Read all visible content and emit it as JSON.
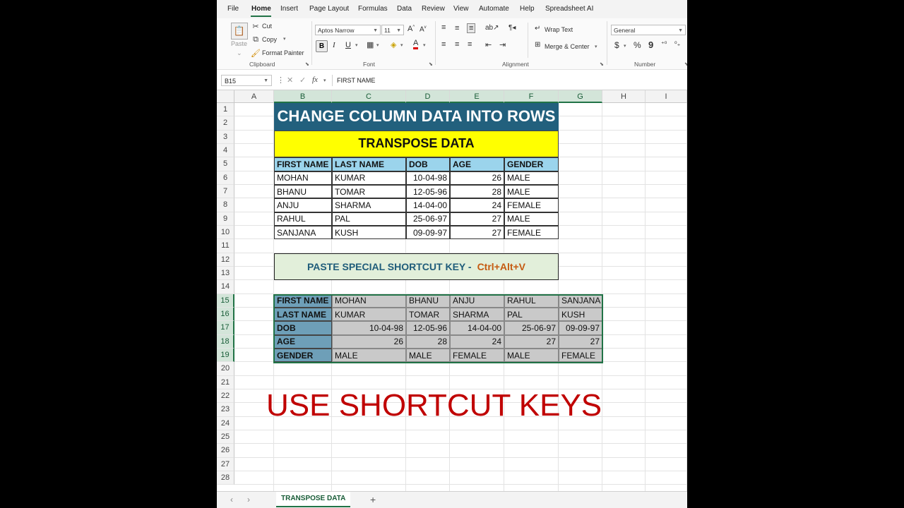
{
  "ribbon": {
    "tabs": [
      "File",
      "Home",
      "Insert",
      "Page Layout",
      "Formulas",
      "Data",
      "Review",
      "View",
      "Automate",
      "Help",
      "Spreadsheet AI"
    ],
    "active_tab": "Home",
    "clipboard": {
      "paste": "Paste",
      "cut": "Cut",
      "copy": "Copy",
      "format_painter": "Format Painter",
      "label": "Clipboard"
    },
    "font": {
      "name": "Aptos Narrow",
      "size": "11",
      "label": "Font"
    },
    "alignment": {
      "wrap_text": "Wrap Text",
      "merge_center": "Merge & Center",
      "label": "Alignment"
    },
    "number": {
      "format": "General",
      "label": "Number"
    }
  },
  "formula_bar": {
    "name_box": "B15",
    "content": "FIRST NAME"
  },
  "grid": {
    "columns": [
      "A",
      "B",
      "C",
      "D",
      "E",
      "F",
      "G",
      "H",
      "I"
    ],
    "rows": [
      "1",
      "2",
      "3",
      "4",
      "5",
      "6",
      "7",
      "8",
      "9",
      "10",
      "11",
      "12",
      "13",
      "14",
      "15",
      "16",
      "17",
      "18",
      "19",
      "20",
      "21",
      "22",
      "23",
      "24",
      "25",
      "26",
      "27",
      "28"
    ]
  },
  "sheet": {
    "title": "CHANGE COLUMN DATA INTO ROWS",
    "subtitle": "TRANSPOSE DATA",
    "table": {
      "headers": [
        "FIRST NAME",
        "LAST NAME",
        "DOB",
        "AGE",
        "GENDER"
      ],
      "rows": [
        [
          "MOHAN",
          "KUMAR",
          "10-04-98",
          "26",
          "MALE"
        ],
        [
          "BHANU",
          "TOMAR",
          "12-05-96",
          "28",
          "MALE"
        ],
        [
          "ANJU",
          "SHARMA",
          "14-04-00",
          "24",
          "FEMALE"
        ],
        [
          "RAHUL",
          "PAL",
          "25-06-97",
          "27",
          "MALE"
        ],
        [
          "SANJANA",
          "KUSH",
          "09-09-97",
          "27",
          "FEMALE"
        ]
      ]
    },
    "paste_special": {
      "label": "PASTE SPECIAL SHORTCUT KEY -",
      "keys": "Ctrl+Alt+V"
    },
    "transposed": [
      [
        "FIRST NAME",
        "MOHAN",
        "BHANU",
        "ANJU",
        "RAHUL",
        "SANJANA"
      ],
      [
        "LAST NAME",
        "KUMAR",
        "TOMAR",
        "SHARMA",
        "PAL",
        "KUSH"
      ],
      [
        "DOB",
        "10-04-98",
        "12-05-96",
        "14-04-00",
        "25-06-97",
        "09-09-97"
      ],
      [
        "AGE",
        "26",
        "28",
        "24",
        "27",
        "27"
      ],
      [
        "GENDER",
        "MALE",
        "MALE",
        "FEMALE",
        "MALE",
        "FEMALE"
      ]
    ],
    "caption": "USE SHORTCUT KEYS"
  },
  "sheet_tabs": {
    "active": "TRANSPOSE DATA",
    "add": "+",
    "prev": "‹",
    "next": "›"
  }
}
